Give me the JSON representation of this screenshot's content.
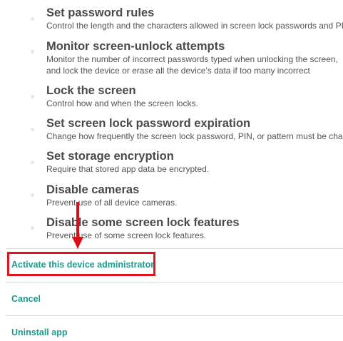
{
  "policies": [
    {
      "title": "Set password rules",
      "description": "Control the length and the characters allowed in screen lock passwords and PINs."
    },
    {
      "title": "Monitor screen-unlock attempts",
      "description": "Monitor the number of incorrect passwords typed when unlocking the screen, and lock the device or erase all the device's data if too many incorrect passwords are typed."
    },
    {
      "title": "Lock the screen",
      "description": "Control how and when the screen locks."
    },
    {
      "title": "Set screen lock password expiration",
      "description": "Change how frequently the screen lock password, PIN, or pattern must be changed."
    },
    {
      "title": "Set storage encryption",
      "description": "Require that stored app data be encrypted."
    },
    {
      "title": "Disable cameras",
      "description": "Prevent use of all device cameras."
    },
    {
      "title": "Disable some screen lock features",
      "description": "Prevent use of some screen lock features."
    }
  ],
  "actions": {
    "activate_label": "Activate this device administrator",
    "cancel_label": "Cancel",
    "uninstall_label": "Uninstall app"
  },
  "colors": {
    "accent": "#1a9c8f",
    "annotation": "#e0141e"
  }
}
